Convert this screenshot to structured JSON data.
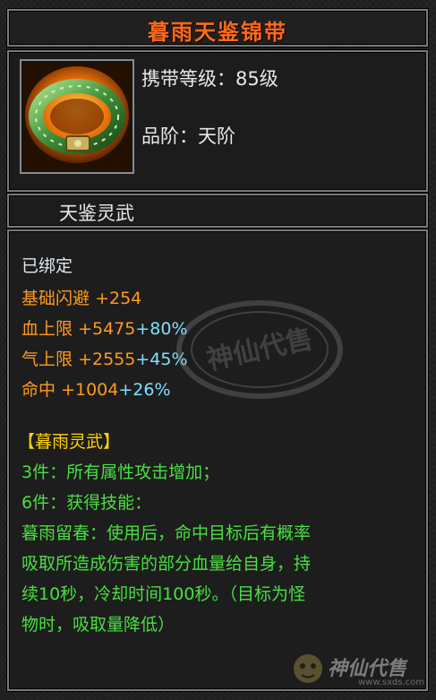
{
  "item": {
    "name": "暮雨天鉴锦带",
    "level_label": "携带等级：",
    "level_value": "85级",
    "grade_label": "品阶：",
    "grade_value": "天阶",
    "set_name": "天鉴灵武"
  },
  "stats": {
    "bound": "已绑定",
    "lines": [
      {
        "label": "基础闪避",
        "value": "+254",
        "pct": ""
      },
      {
        "label": "血上限",
        "value": "+5475",
        "pct": "+80%"
      },
      {
        "label": "气上限",
        "value": "+2555",
        "pct": "+45%"
      },
      {
        "label": "命中",
        "value": "+1004",
        "pct": "+26%"
      }
    ]
  },
  "set_bonus": {
    "title": "【暮雨灵武】",
    "lines": [
      "3件：所有属性攻击增加；",
      "6件：获得技能：",
      "暮雨留春：使用后，命中目标后有概率",
      "吸取所造成伤害的部分血量给自身，持",
      "续10秒，冷却时间100秒。（目标为怪",
      "物时，吸取量降低）"
    ]
  },
  "watermark": {
    "text": "神仙代售"
  },
  "logo": {
    "text": "神仙代售",
    "url": "www.sxds.com"
  },
  "colors": {
    "title": "#ff6a1a",
    "stat": "#ff9a1e",
    "percent": "#7fe0ff",
    "set_title": "#ffd20a",
    "set_text": "#48e040",
    "border": "#7a7a7a"
  }
}
